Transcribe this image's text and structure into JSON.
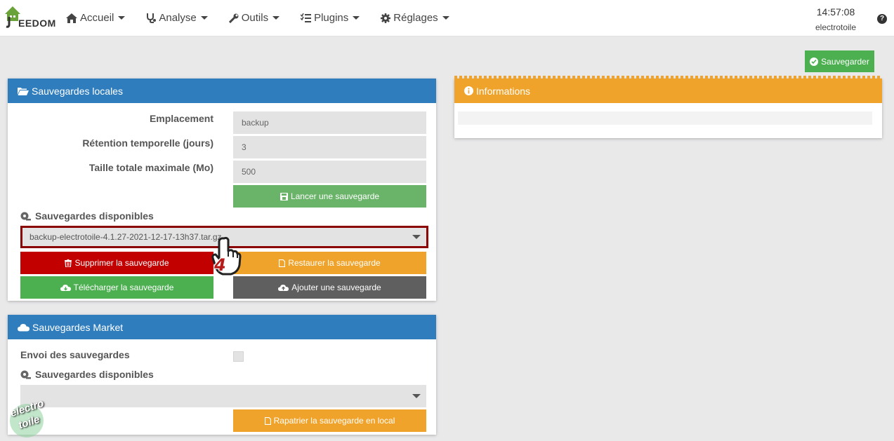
{
  "nav": {
    "logo_letter": "EEDOM",
    "menu": [
      {
        "label": "Accueil",
        "icon": "home-icon"
      },
      {
        "label": "Analyse",
        "icon": "stethoscope-icon"
      },
      {
        "label": "Outils",
        "icon": "wrench-icon"
      },
      {
        "label": "Plugins",
        "icon": "tasks-icon"
      },
      {
        "label": "Réglages",
        "icon": "cog-icon"
      }
    ],
    "time": "14:57:08",
    "hostname": "electrotoile",
    "help": "?"
  },
  "toolbar": {
    "save_label": "Sauvegarder"
  },
  "local": {
    "title": "Sauvegardes locales",
    "fields": [
      {
        "label": "Emplacement",
        "value": "backup"
      },
      {
        "label": "Rétention temporelle (jours)",
        "value": "3"
      },
      {
        "label": "Taille totale maximale (Mo)",
        "value": "500"
      }
    ],
    "launch_label": "Lancer une sauvegarde",
    "available_label": "Sauvegardes disponibles",
    "selected_backup": "backup-electrotoile-4.1.27-2021-12-17-13h37.tar.gz",
    "delete_label": "Supprimer la sauvegarde",
    "restore_label": "Restaurer la sauvegarde",
    "download_label": "Télécharger la sauvegarde",
    "add_label": "Ajouter une sauvegarde"
  },
  "info": {
    "title": "Informations"
  },
  "market": {
    "title": "Sauvegardes Market",
    "send_label": "Envoi des sauvegardes",
    "available_label": "Sauvegardes disponibles",
    "selected_backup": "",
    "repatriate_label": "Rapatrier la sauvegarde en local"
  },
  "annotation": {
    "step": "4"
  },
  "watermark": {
    "line1": "electro",
    "line2": "toile"
  }
}
